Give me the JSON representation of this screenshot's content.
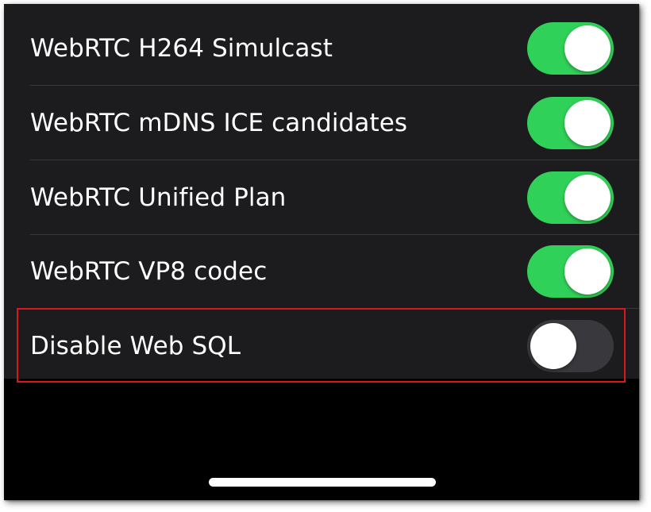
{
  "settings": {
    "items": [
      {
        "label": "WebRTC H264 Simulcast",
        "enabled": true
      },
      {
        "label": "WebRTC mDNS ICE candidates",
        "enabled": true
      },
      {
        "label": "WebRTC Unified Plan",
        "enabled": true
      },
      {
        "label": "WebRTC VP8 codec",
        "enabled": true
      },
      {
        "label": "Disable Web SQL",
        "enabled": false
      }
    ]
  },
  "colors": {
    "toggle_on": "#30d158",
    "toggle_off": "#39393d",
    "row_background": "#1c1c1e",
    "highlight_border": "#d9181e"
  },
  "icons": [
    "toggle-switch",
    "home-indicator"
  ]
}
